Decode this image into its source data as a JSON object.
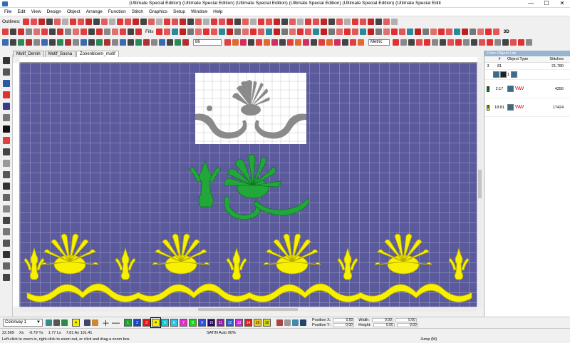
{
  "window": {
    "title": "(Ultimate Special Edition) (Ultimate Special Edition) (Ultimate Special Edition) (Ultimate Special Edition) (Ultimate Special Edition) (Ultimate Special Editi",
    "min": "—",
    "max": "☐",
    "close": "✕"
  },
  "menu": [
    "File",
    "Edit",
    "View",
    "Design",
    "Object",
    "Arrange",
    "Function",
    "Stitch",
    "Graphics",
    "Setup",
    "Window",
    "Help"
  ],
  "toolbar": {
    "outlines_label": "Outlines:",
    "fills_label": "Fills",
    "zoom_value": "86",
    "units_value": "Metric",
    "view_3d": "3D"
  },
  "tabs": [
    "Motif_Denim",
    "Motif_Sosna",
    "Zonenbloem_motif"
  ],
  "panel": {
    "title": "Color-Object List",
    "headers": [
      "#",
      "Object Type",
      "Stitches"
    ],
    "rows": [
      {
        "num": "3",
        "a": "81",
        "b": "",
        "stitches": "21,780",
        "swatch": "",
        "swatch_color": ""
      },
      {
        "num": "",
        "a": "1",
        "b": "",
        "stitches": "",
        "swatch": "",
        "swatch_color": ""
      },
      {
        "num": "",
        "a": "2:17",
        "b": "",
        "stitches": "4356",
        "swatch": "3",
        "swatch_color": "#11aa33"
      },
      {
        "num": "",
        "a": "18:81",
        "b": "",
        "stitches": "17424",
        "swatch": "4",
        "swatch_color": "#f5f000"
      }
    ]
  },
  "bottom": {
    "colorway": "Colorway 1",
    "palette": [
      {
        "n": "1",
        "c": "#1fa032"
      },
      {
        "n": "2",
        "c": "#1c44c6"
      },
      {
        "n": "3",
        "c": "#e01818"
      },
      {
        "n": "4",
        "c": "#f2ef00"
      },
      {
        "n": "5",
        "c": "#18c8d0"
      },
      {
        "n": "6",
        "c": "#2ac2e8"
      },
      {
        "n": "7",
        "c": "#e030c8"
      },
      {
        "n": "8",
        "c": "#20d020"
      },
      {
        "n": "9",
        "c": "#3050e0"
      },
      {
        "n": "10",
        "c": "#2a0a60"
      },
      {
        "n": "11",
        "c": "#9020a0"
      },
      {
        "n": "12",
        "c": "#2a60c0"
      },
      {
        "n": "13",
        "c": "#d028d0"
      },
      {
        "n": "14",
        "c": "#e02020"
      },
      {
        "n": "15",
        "c": "#e8c020"
      },
      {
        "n": "16",
        "c": "#d8d800"
      }
    ],
    "selected_index": 3,
    "extra_swatch_label": "4",
    "position_x_label": "Position X:",
    "position_y_label": "Position Y:",
    "width_label": "Width:",
    "height_label": "Height:",
    "px": "0.00",
    "py": "0.00",
    "w": "0.00",
    "h": "0.00",
    "w2": "0.00",
    "h2": "0.00"
  },
  "status": {
    "x": "22.569",
    "xs": "Xs",
    "v1": "-0.79 Ys",
    "v2": "1.77 Ls",
    "v3": "7.81 Ax 101.41",
    "stitch": "SATIN Auto 90%",
    "hint": "Left-click to zoom in, right-click to zoom out, or click and drag a zoom box.",
    "jump": "Jump (M)"
  },
  "colors": {
    "canvas": "#5a5a9c",
    "green": "#22a83a",
    "yellow": "#f7f000",
    "grey_motif": "#8a8a8a"
  }
}
